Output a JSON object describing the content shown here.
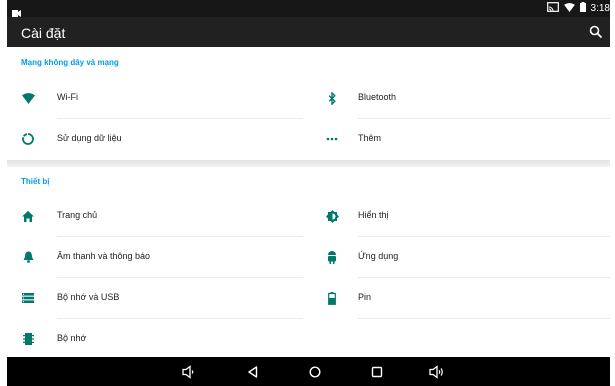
{
  "status_bar": {
    "time": "3:18",
    "icons": [
      "video-camera-icon",
      "cast-icon",
      "wifi-icon",
      "battery-icon"
    ]
  },
  "app_bar": {
    "title": "Cài đặt",
    "search_icon": "search-icon"
  },
  "sections": {
    "wireless": {
      "header": "Mạng không dây và mạng",
      "items": [
        {
          "label": "Wi-Fi",
          "icon": "wifi-icon"
        },
        {
          "label": "Bluetooth",
          "icon": "bluetooth-icon"
        },
        {
          "label": "Sử dụng dữ liệu",
          "icon": "data-usage-icon"
        },
        {
          "label": "Thêm",
          "icon": "more-icon"
        }
      ]
    },
    "device": {
      "header": "Thiết bị",
      "items": [
        {
          "label": "Trang chủ",
          "icon": "home-icon"
        },
        {
          "label": "Hiển thị",
          "icon": "display-icon"
        },
        {
          "label": "Âm thanh và thông báo",
          "icon": "bell-icon"
        },
        {
          "label": "Ứng dụng",
          "icon": "android-icon"
        },
        {
          "label": "Bộ nhớ và USB",
          "icon": "storage-icon"
        },
        {
          "label": "Pin",
          "icon": "battery-icon"
        },
        {
          "label": "Bộ nhớ",
          "icon": "memory-icon"
        }
      ]
    }
  },
  "nav_bar": {
    "buttons": [
      "volume-down-icon",
      "back-icon",
      "home-icon",
      "recents-icon",
      "volume-up-icon"
    ]
  },
  "colors": {
    "accent": "#039be5",
    "icon_teal": "#00796b",
    "app_bar": "#212121",
    "status_bar": "#171717"
  }
}
